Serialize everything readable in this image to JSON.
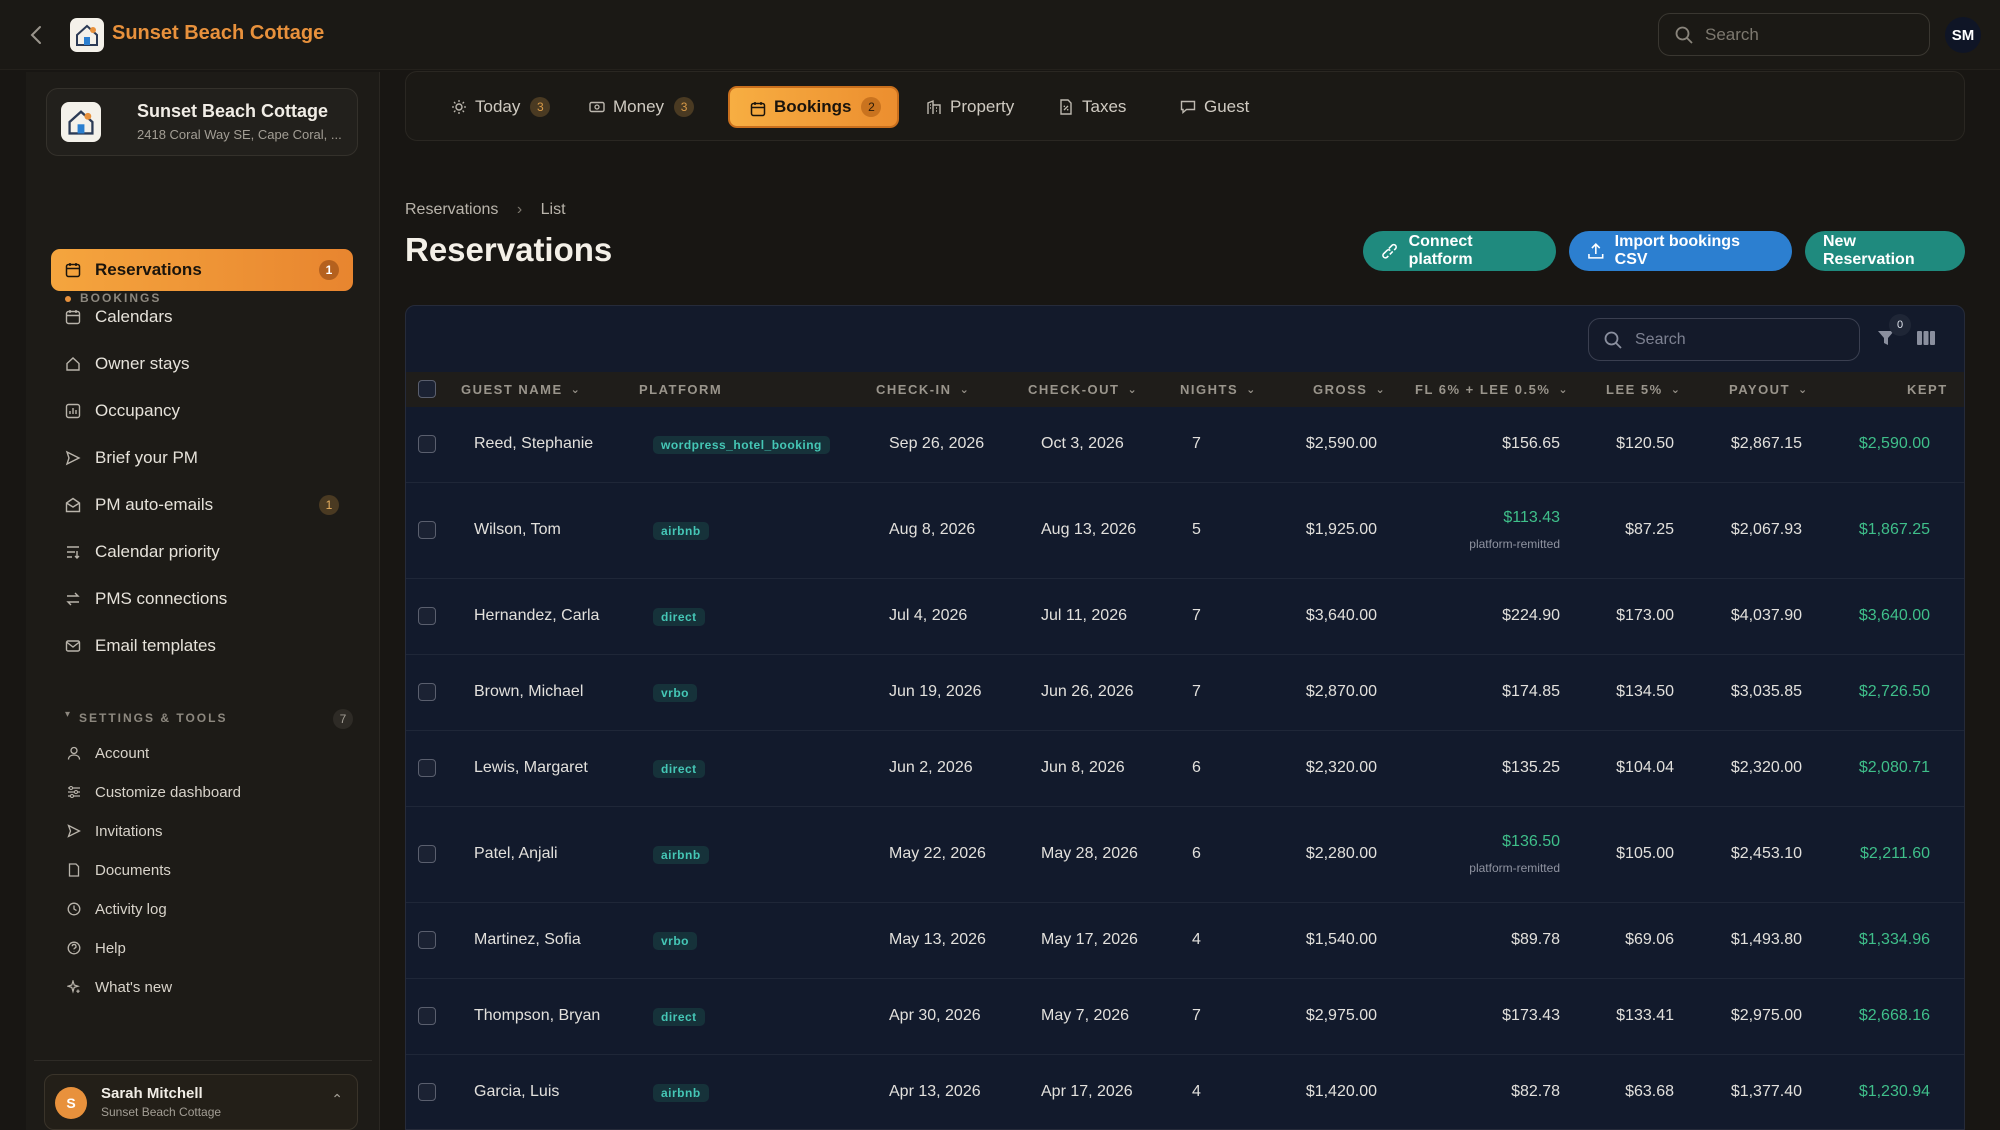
{
  "app": {
    "title": "Sunset Beach Cottage"
  },
  "topbar": {
    "search_placeholder": "Search",
    "user_initials": "SM"
  },
  "sidebar": {
    "property": {
      "name": "Sunset Beach Cottage",
      "address": "2418 Coral Way SE, Cape Coral, ..."
    },
    "bookings_section": "BOOKINGS",
    "items": [
      {
        "label": "Reservations",
        "badge": "1",
        "icon": "calendar-icon",
        "active": true
      },
      {
        "label": "Calendars",
        "icon": "calendar-icon"
      },
      {
        "label": "Owner stays",
        "icon": "home-icon"
      },
      {
        "label": "Occupancy",
        "icon": "chart-icon"
      },
      {
        "label": "Brief your PM",
        "icon": "send-icon"
      },
      {
        "label": "PM auto-emails",
        "badge": "1",
        "icon": "mail-open-icon"
      },
      {
        "label": "Calendar priority",
        "icon": "priority-icon"
      },
      {
        "label": "PMS connections",
        "icon": "swap-icon"
      },
      {
        "label": "Email templates",
        "icon": "mail-icon"
      }
    ],
    "settings_section": "SETTINGS & TOOLS",
    "settings_badge": "7",
    "settings_items": [
      {
        "label": "Account",
        "icon": "user-icon"
      },
      {
        "label": "Customize dashboard",
        "icon": "sliders-icon"
      },
      {
        "label": "Invitations",
        "icon": "send-icon"
      },
      {
        "label": "Documents",
        "icon": "document-icon"
      },
      {
        "label": "Activity log",
        "icon": "clock-icon"
      },
      {
        "label": "Help",
        "icon": "help-icon"
      },
      {
        "label": "What's new",
        "icon": "sparkle-icon"
      }
    ],
    "user": {
      "initial": "S",
      "name": "Sarah Mitchell",
      "property": "Sunset Beach Cottage"
    }
  },
  "tabs": [
    {
      "label": "Today",
      "badge": "3",
      "icon": "sun-icon"
    },
    {
      "label": "Money",
      "badge": "3",
      "icon": "money-icon"
    },
    {
      "label": "Bookings",
      "badge": "2",
      "icon": "calendar-icon",
      "active": true
    },
    {
      "label": "Property",
      "icon": "building-icon"
    },
    {
      "label": "Taxes",
      "icon": "tax-document-icon"
    },
    {
      "label": "Guest",
      "icon": "chat-icon"
    }
  ],
  "breadcrumb": {
    "root": "Reservations",
    "current": "List"
  },
  "page": {
    "title": "Reservations"
  },
  "actions": {
    "connect": "Connect platform",
    "import": "Import bookings CSV",
    "new": "New Reservation"
  },
  "table": {
    "search_placeholder": "Search",
    "filter_count": "0",
    "columns": [
      "GUEST NAME",
      "PLATFORM",
      "CHECK-IN",
      "CHECK-OUT",
      "NIGHTS",
      "GROSS",
      "FL 6% + LEE 0.5%",
      "LEE 5%",
      "PAYOUT",
      "KEPT"
    ],
    "remit_note": "platform-remitted",
    "rows": [
      {
        "guest": "Reed, Stephanie",
        "platform": "wordpress_hotel_booking",
        "checkin": "Sep 26, 2026",
        "checkout": "Oct 3, 2026",
        "nights": "7",
        "gross": "$2,590.00",
        "fl": "$156.65",
        "lee": "$120.50",
        "payout": "$2,867.15",
        "kept": "$2,590.00"
      },
      {
        "guest": "Wilson, Tom",
        "platform": "airbnb",
        "checkin": "Aug 8, 2026",
        "checkout": "Aug 13, 2026",
        "nights": "5",
        "gross": "$1,925.00",
        "fl": "$113.43",
        "remitted": true,
        "lee": "$87.25",
        "payout": "$2,067.93",
        "kept": "$1,867.25"
      },
      {
        "guest": "Hernandez, Carla",
        "platform": "direct",
        "checkin": "Jul 4, 2026",
        "checkout": "Jul 11, 2026",
        "nights": "7",
        "gross": "$3,640.00",
        "fl": "$224.90",
        "lee": "$173.00",
        "payout": "$4,037.90",
        "kept": "$3,640.00"
      },
      {
        "guest": "Brown, Michael",
        "platform": "vrbo",
        "checkin": "Jun 19, 2026",
        "checkout": "Jun 26, 2026",
        "nights": "7",
        "gross": "$2,870.00",
        "fl": "$174.85",
        "lee": "$134.50",
        "payout": "$3,035.85",
        "kept": "$2,726.50"
      },
      {
        "guest": "Lewis, Margaret",
        "platform": "direct",
        "checkin": "Jun 2, 2026",
        "checkout": "Jun 8, 2026",
        "nights": "6",
        "gross": "$2,320.00",
        "fl": "$135.25",
        "lee": "$104.04",
        "payout": "$2,320.00",
        "kept": "$2,080.71"
      },
      {
        "guest": "Patel, Anjali",
        "platform": "airbnb",
        "checkin": "May 22, 2026",
        "checkout": "May 28, 2026",
        "nights": "6",
        "gross": "$2,280.00",
        "fl": "$136.50",
        "remitted": true,
        "lee": "$105.00",
        "payout": "$2,453.10",
        "kept": "$2,211.60"
      },
      {
        "guest": "Martinez, Sofia",
        "platform": "vrbo",
        "checkin": "May 13, 2026",
        "checkout": "May 17, 2026",
        "nights": "4",
        "gross": "$1,540.00",
        "fl": "$89.78",
        "lee": "$69.06",
        "payout": "$1,493.80",
        "kept": "$1,334.96"
      },
      {
        "guest": "Thompson, Bryan",
        "platform": "direct",
        "checkin": "Apr 30, 2026",
        "checkout": "May 7, 2026",
        "nights": "7",
        "gross": "$2,975.00",
        "fl": "$173.43",
        "lee": "$133.41",
        "payout": "$2,975.00",
        "kept": "$2,668.16"
      },
      {
        "guest": "Garcia, Luis",
        "platform": "airbnb",
        "checkin": "Apr 13, 2026",
        "checkout": "Apr 17, 2026",
        "nights": "4",
        "gross": "$1,420.00",
        "fl": "$82.78",
        "lee": "$63.68",
        "payout": "$1,377.40",
        "kept": "$1,230.94"
      }
    ]
  },
  "colors": {
    "accent": "#e8913c",
    "teal": "#1f8a7e",
    "blue": "#2c7fd0",
    "kept": "#3fbf8a"
  }
}
